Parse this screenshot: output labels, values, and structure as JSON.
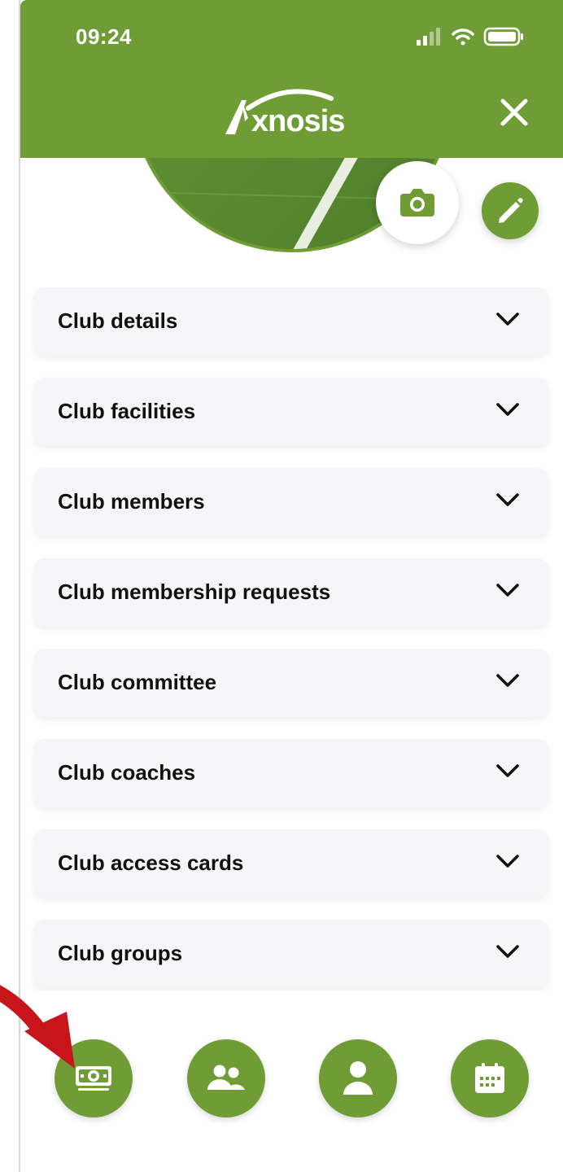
{
  "status_bar": {
    "time": "09:24"
  },
  "header": {
    "brand": "Axnosis"
  },
  "menu": {
    "items": [
      {
        "label": "Club details"
      },
      {
        "label": "Club facilities"
      },
      {
        "label": "Club members"
      },
      {
        "label": "Club membership requests"
      },
      {
        "label": "Club committee"
      },
      {
        "label": "Club coaches"
      },
      {
        "label": "Club access cards"
      },
      {
        "label": "Club groups"
      }
    ]
  },
  "bottom_nav": {
    "items": [
      {
        "icon": "money-icon"
      },
      {
        "icon": "users-icon"
      },
      {
        "icon": "user-icon"
      },
      {
        "icon": "calendar-icon"
      }
    ]
  },
  "colors": {
    "brand_green": "#6f9c35",
    "card_bg": "#f6f6f9",
    "annotation_red": "#c8141b"
  }
}
